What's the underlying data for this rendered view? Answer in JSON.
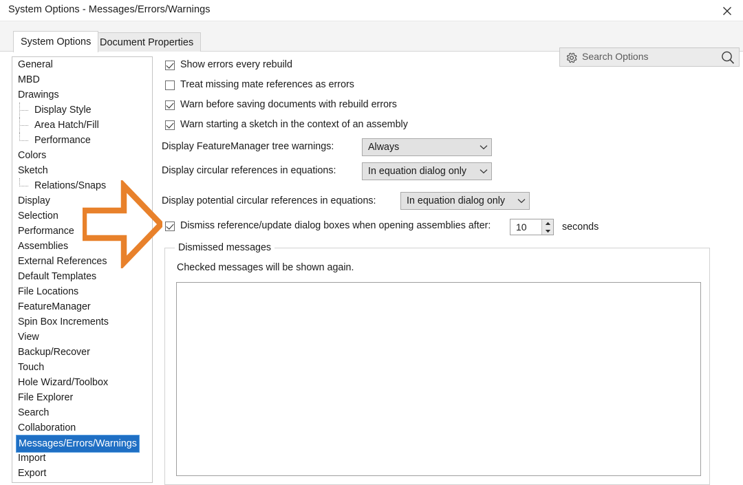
{
  "window": {
    "title": "System Options - Messages/Errors/Warnings",
    "close_label": "✕"
  },
  "tabs": [
    {
      "label": "System Options",
      "active": true
    },
    {
      "label": "Document Properties",
      "active": false
    }
  ],
  "search": {
    "placeholder": "Search Options",
    "value": "",
    "gear_icon": "gear-icon",
    "magnifier_icon": "search-icon"
  },
  "sidebar": {
    "selected": "Messages/Errors/Warnings",
    "items": [
      {
        "label": "General",
        "level": 0,
        "selected": false
      },
      {
        "label": "MBD",
        "level": 0,
        "selected": false
      },
      {
        "label": "Drawings",
        "level": 0,
        "selected": false
      },
      {
        "label": "Display Style",
        "level": 1,
        "selected": false
      },
      {
        "label": "Area Hatch/Fill",
        "level": 1,
        "selected": false
      },
      {
        "label": "Performance",
        "level": 1,
        "selected": false,
        "last": true
      },
      {
        "label": "Colors",
        "level": 0,
        "selected": false
      },
      {
        "label": "Sketch",
        "level": 0,
        "selected": false
      },
      {
        "label": "Relations/Snaps",
        "level": 1,
        "selected": false,
        "last": true
      },
      {
        "label": "Display",
        "level": 0,
        "selected": false
      },
      {
        "label": "Selection",
        "level": 0,
        "selected": false
      },
      {
        "label": "Performance",
        "level": 0,
        "selected": false
      },
      {
        "label": "Assemblies",
        "level": 0,
        "selected": false
      },
      {
        "label": "External References",
        "level": 0,
        "selected": false
      },
      {
        "label": "Default Templates",
        "level": 0,
        "selected": false
      },
      {
        "label": "File Locations",
        "level": 0,
        "selected": false
      },
      {
        "label": "FeatureManager",
        "level": 0,
        "selected": false
      },
      {
        "label": "Spin Box Increments",
        "level": 0,
        "selected": false
      },
      {
        "label": "View",
        "level": 0,
        "selected": false
      },
      {
        "label": "Backup/Recover",
        "level": 0,
        "selected": false
      },
      {
        "label": "Touch",
        "level": 0,
        "selected": false
      },
      {
        "label": "Hole Wizard/Toolbox",
        "level": 0,
        "selected": false
      },
      {
        "label": "File Explorer",
        "level": 0,
        "selected": false
      },
      {
        "label": "Search",
        "level": 0,
        "selected": false
      },
      {
        "label": "Collaboration",
        "level": 0,
        "selected": false
      },
      {
        "label": "Messages/Errors/Warnings",
        "level": 0,
        "selected": true
      },
      {
        "label": "Import",
        "level": 0,
        "selected": false
      },
      {
        "label": "Export",
        "level": 0,
        "selected": false
      }
    ]
  },
  "main": {
    "checkboxes": [
      {
        "label": "Show errors every rebuild",
        "checked": true
      },
      {
        "label": "Treat missing mate references as errors",
        "checked": false
      },
      {
        "label": "Warn before saving documents with rebuild errors",
        "checked": true
      },
      {
        "label": "Warn starting a sketch in the context of an assembly",
        "checked": true
      }
    ],
    "dropdowns": [
      {
        "label": "Display FeatureManager tree warnings:",
        "value": "Always"
      },
      {
        "label": "Display circular references in equations:",
        "value": "In equation dialog only"
      },
      {
        "label": "Display potential circular references in equations:",
        "value": "In equation dialog only"
      }
    ],
    "dismiss_row": {
      "label": "Dismiss reference/update dialog boxes when opening assemblies after:",
      "checked": true,
      "seconds_value": "10",
      "seconds_unit": "seconds"
    },
    "group": {
      "legend": "Dismissed messages",
      "caption": "Checked messages will be shown again.",
      "list_items": []
    }
  },
  "annotation": {
    "arrow_color": "#E8812B",
    "arrow_name": "orange-callout-arrow"
  }
}
